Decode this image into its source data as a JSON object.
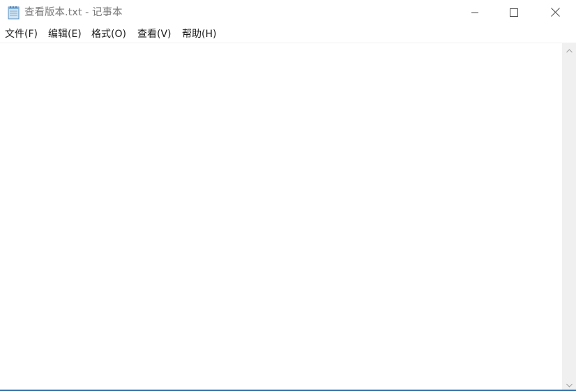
{
  "window": {
    "title": "查看版本.txt - 记事本",
    "icon": "notepad-icon"
  },
  "caption_buttons": {
    "minimize": "minimize-icon",
    "maximize": "maximize-icon",
    "close": "close-icon"
  },
  "menu": {
    "items": [
      {
        "label": "文件(F)"
      },
      {
        "label": "编辑(E)"
      },
      {
        "label": "格式(O)"
      },
      {
        "label": "查看(V)"
      },
      {
        "label": "帮助(H)"
      }
    ]
  },
  "editor": {
    "content": ""
  },
  "colors": {
    "title_text": "#7b7b7b",
    "menu_text": "#1a1a1a",
    "scrollbar_track": "#f0f0f0",
    "taskbar_edge": "#2f6fa8"
  }
}
